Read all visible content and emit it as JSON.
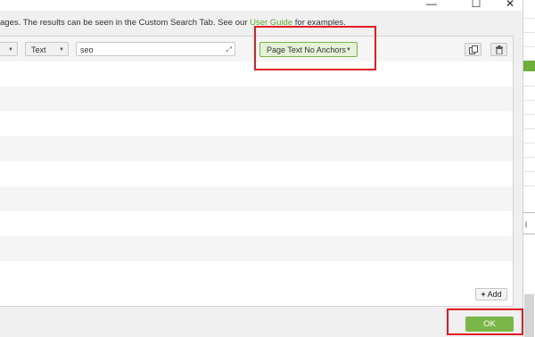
{
  "window": {
    "minimize_glyph": "—",
    "maximize_glyph": "☐",
    "close_glyph": "✕"
  },
  "description": {
    "text_before": "ages. The results can be seen in the Custom Search Tab. See our ",
    "link": "User Guide",
    "text_after": " for examples."
  },
  "filter_row": {
    "first_select_value": "",
    "second_select_value": "Text",
    "search_value": "seo",
    "scope_select_value": "Page Text No Anchors",
    "duplicate_icon": "copy-icon",
    "delete_icon": "trash-icon"
  },
  "buttons": {
    "add_label": "Add",
    "add_glyph": "+",
    "ok_label": "OK"
  },
  "right_panel": {
    "partial_label": "l"
  },
  "colors": {
    "accent_green": "#7ab648",
    "highlight_red": "#e31b23"
  }
}
